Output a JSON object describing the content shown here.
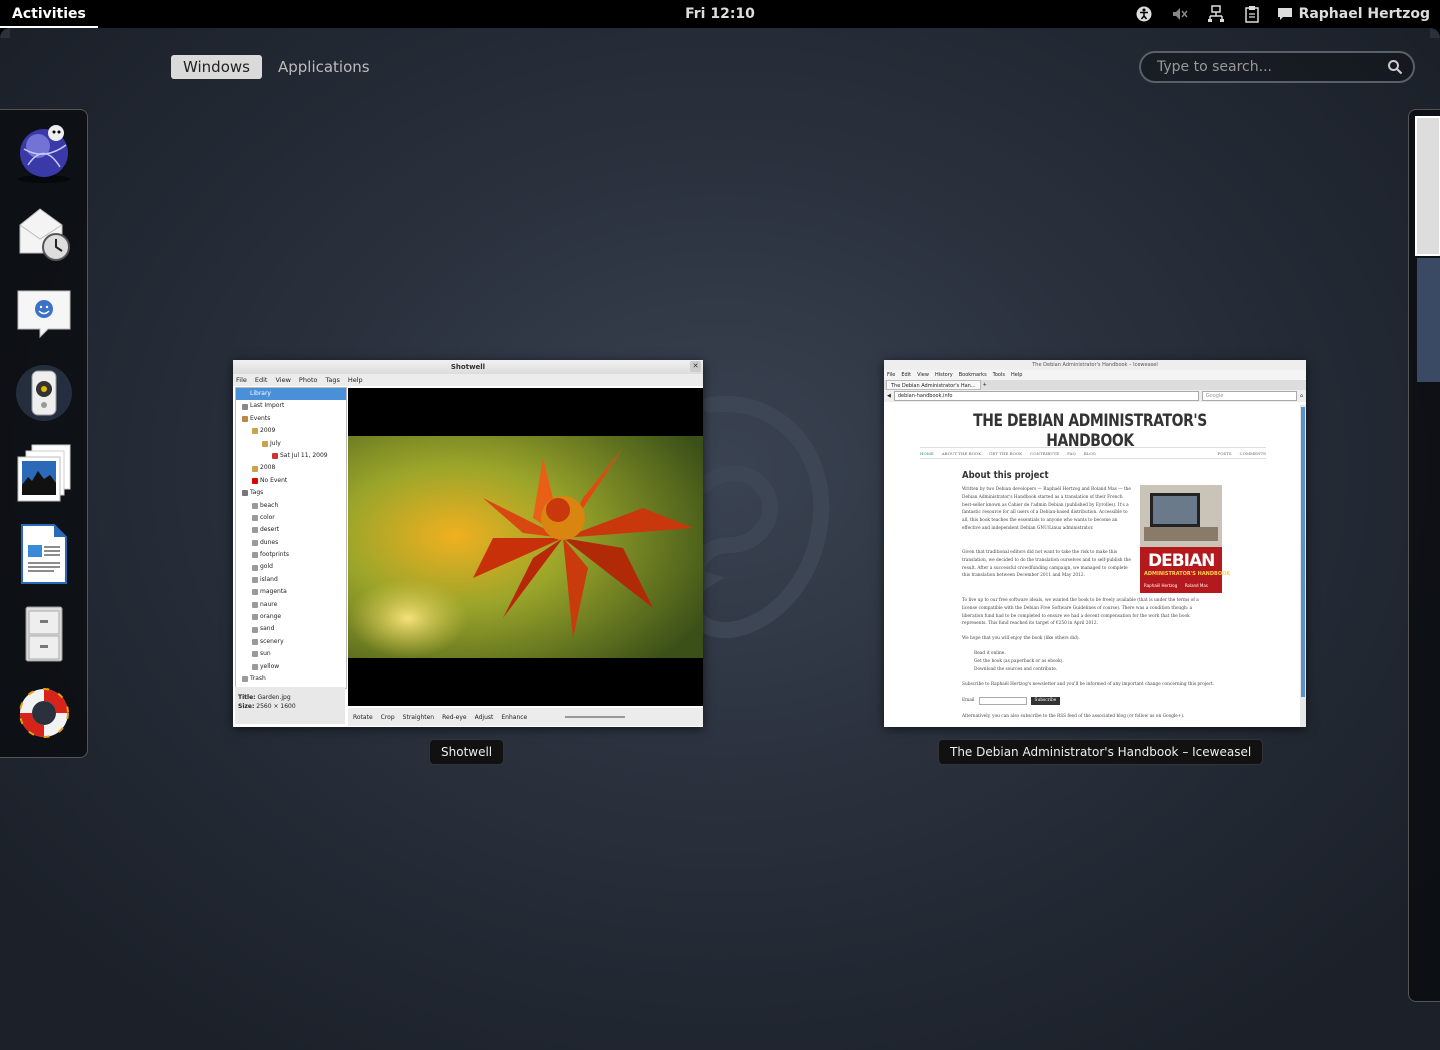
{
  "topbar": {
    "activities": "Activities",
    "clock": "Fri 12:10",
    "user": "Raphael Hertzog"
  },
  "view_tabs": [
    "Windows",
    "Applications"
  ],
  "search": {
    "placeholder": "Type to search..."
  },
  "dash": {
    "items": [
      "web-browser-icon",
      "evolution-mail-calendar-icon",
      "empathy-chat-icon",
      "rhythmbox-music-icon",
      "shotwell-photos-icon",
      "libreoffice-writer-icon",
      "files-cabinet-icon",
      "help-lifebuoy-icon"
    ]
  },
  "windows": [
    {
      "caption": "Shotwell",
      "title": "Shotwell",
      "menu": [
        "File",
        "Edit",
        "View",
        "Photo",
        "Tags",
        "Help"
      ],
      "sidebar": [
        {
          "label": "Library",
          "indent": 0,
          "selected": true
        },
        {
          "label": "Last Import",
          "indent": 0
        },
        {
          "label": "Events",
          "indent": 0
        },
        {
          "label": "2009",
          "indent": 1
        },
        {
          "label": "July",
          "indent": 2
        },
        {
          "label": "Sat Jul 11, 2009",
          "indent": 3
        },
        {
          "label": "2008",
          "indent": 1
        },
        {
          "label": "No Event",
          "indent": 1
        },
        {
          "label": "Tags",
          "indent": 0
        },
        {
          "label": "beach",
          "indent": 1
        },
        {
          "label": "color",
          "indent": 1
        },
        {
          "label": "desert",
          "indent": 1
        },
        {
          "label": "dunes",
          "indent": 1
        },
        {
          "label": "footprints",
          "indent": 1
        },
        {
          "label": "gold",
          "indent": 1
        },
        {
          "label": "island",
          "indent": 1
        },
        {
          "label": "magenta",
          "indent": 1
        },
        {
          "label": "naure",
          "indent": 1
        },
        {
          "label": "orange",
          "indent": 1
        },
        {
          "label": "sand",
          "indent": 1
        },
        {
          "label": "scenery",
          "indent": 1
        },
        {
          "label": "sun",
          "indent": 1
        },
        {
          "label": "yellow",
          "indent": 1
        },
        {
          "label": "Trash",
          "indent": 0
        }
      ],
      "info_title_label": "Title:",
      "info_title": "Garden.jpg",
      "info_size_label": "Size:",
      "info_size": "2560 × 1600",
      "tools": [
        "Rotate",
        "Crop",
        "Straighten",
        "Red-eye",
        "Adjust",
        "Enhance"
      ]
    },
    {
      "caption": "The Debian Administrator's Handbook – Iceweasel",
      "title": "The Debian Administrator's Handbook – Iceweasel",
      "menu": [
        "File",
        "Edit",
        "View",
        "History",
        "Bookmarks",
        "Tools",
        "Help"
      ],
      "tab": "The Debian Administrator's Han...",
      "url": "debian-handbook.info",
      "search_engine": "Google",
      "page": {
        "heading": "THE DEBIAN ADMINISTRATOR'S HANDBOOK",
        "nav": [
          "HOME",
          "ABOUT THE BOOK",
          "GET THE BOOK",
          "CONTRIBUTE",
          "FAQ",
          "BLOG"
        ],
        "feeds": [
          "POSTS",
          "COMMENTS"
        ],
        "about_title": "About this project",
        "p1": "Written by two Debian developers — Raphaël Hertzog and Roland Mas — the Debian Administrator's Handbook started as a translation of their French best-seller known as Cahier de l'admin Debian (published by Eyrolles). It's a fantastic resource for all users of a Debian-based distribution. Accessible to all, this book teaches the essentials to anyone who wants to become an effective and independent Debian GNU/Linux administrator.",
        "p2": "Given that traditional editors did not want to take the risk to make this translation, we decided to do the translation ourselves and to self-publish the result. After a successful crowdfunding campaign, we managed to complete this translation between December 2011 and May 2012.",
        "p3": "To live up to our free software ideals, we wanted the book to be freely available (that is under the terms of a license compatible with the Debian Free Software Guidelines of course). There was a condition though: a liberation fund had to be completed to ensure we had a decent compensation for the work that the book represents. This fund reached its target of €250 in April 2012.",
        "p4": "We hope that you will enjoy the book (like others did).",
        "list": [
          "Read it online.",
          "Get the book (as paperback or as ebook).",
          "Download the sources and contribute."
        ],
        "p5": "Subscribe to Raphaël Hertzog's newsletter and you'll be informed of any important change concerning this project.",
        "email_label": "Email",
        "subscribe": "Subscribe",
        "p6": "Alternatively, you can also subscribe to the RSS feed of the associated blog (or follow us on Google+).",
        "cover_title": "DEBIAN",
        "cover_sub": "ADMINISTRATOR'S HANDBOOK",
        "cover_authors": "Raphaël Hertzog      Roland Mas"
      }
    }
  ],
  "colors": {
    "accent": "#4a90d9",
    "panel": "#000000",
    "cover": "#b41a1d"
  }
}
